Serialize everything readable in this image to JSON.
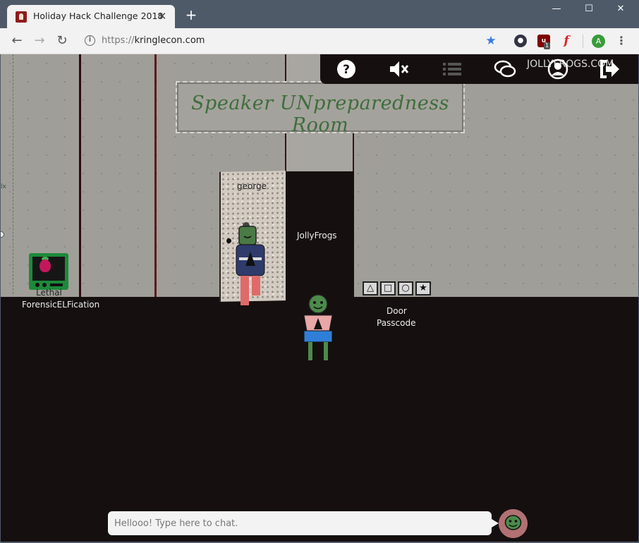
{
  "browser": {
    "tab_title": "Holiday Hack Challenge 2018",
    "tab_close": "✕",
    "new_tab": "+",
    "url_scheme": "https://",
    "url_host": "kringlecon.com",
    "profile_initial": "A",
    "extension_badge": "1",
    "window_controls": [
      "—",
      "☐",
      "✕"
    ]
  },
  "hud": {
    "username": "JOLLYFROGS.COM",
    "icons": [
      "help-icon",
      "mute-icon",
      "list-icon",
      "chat-icon",
      "profile-icon",
      "exit-icon"
    ]
  },
  "scene": {
    "sign_title": "Speaker UNpreparedness Room",
    "door_label": "george",
    "player_name": "JollyFrogs",
    "terminal_label_line1": "Lethal",
    "terminal_label_line2": "ForensicELFication",
    "passcode_label_line1": "Door",
    "passcode_label_line2": "Passcode",
    "keypad_keys": [
      "△",
      "□",
      "○",
      "★"
    ],
    "edge_text": "lx"
  },
  "chat": {
    "placeholder": "Hellooo! Type here to chat."
  },
  "colors": {
    "browser_frame": "#4f5a69",
    "wall": "#a09e98",
    "floor": "#150f0f",
    "sign_text": "#3f6d3c",
    "chat_avatar": "#b07173"
  }
}
